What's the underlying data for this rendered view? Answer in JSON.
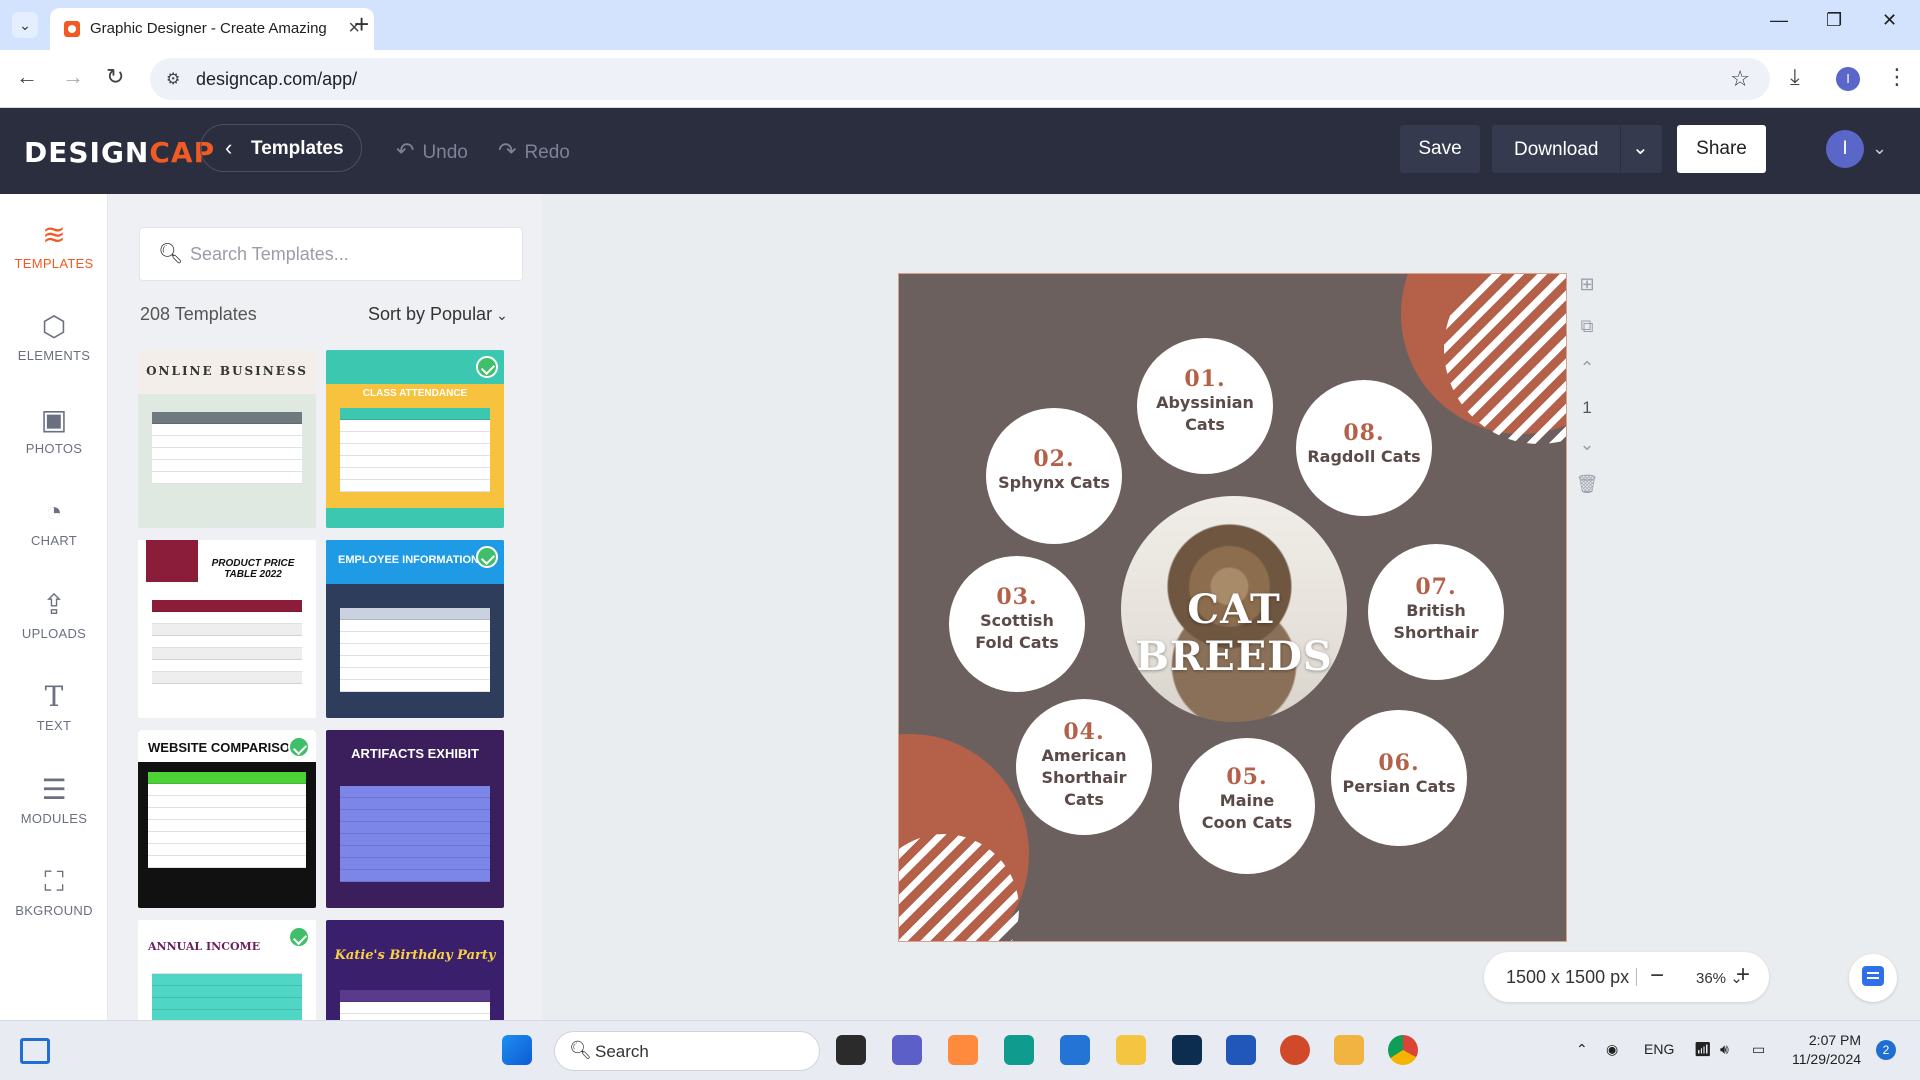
{
  "browser": {
    "tab_title": "Graphic Designer - Create Amazing Graphics",
    "url": "designcap.com/app/",
    "profile_initial": "I"
  },
  "app": {
    "logo_prefix": "DESIGN",
    "logo_suffix": "CAP",
    "templates_button": "Templates",
    "undo": "Undo",
    "redo": "Redo",
    "save": "Save",
    "download": "Download",
    "share": "Share",
    "user_initial": "I"
  },
  "leftnav": [
    {
      "label": "TEMPLATES",
      "icon": "layers-icon",
      "active": true
    },
    {
      "label": "ELEMENTS",
      "icon": "elements-icon"
    },
    {
      "label": "PHOTOS",
      "icon": "photo-icon"
    },
    {
      "label": "CHART",
      "icon": "pie-chart-icon"
    },
    {
      "label": "UPLOADS",
      "icon": "upload-icon"
    },
    {
      "label": "TEXT",
      "icon": "text-icon"
    },
    {
      "label": "MODULES",
      "icon": "list-icon"
    },
    {
      "label": "BKGROUND",
      "icon": "background-icon"
    }
  ],
  "panel": {
    "search_placeholder": "Search Templates...",
    "count": "208 Templates",
    "sort": "Sort by Popular",
    "thumbnails": [
      {
        "title": "ONLINE BUSINESS",
        "premium": false
      },
      {
        "title": "CLASS ATTENDANCE",
        "premium": true
      },
      {
        "title": "PRODUCT PRICE TABLE 2022",
        "premium": false
      },
      {
        "title": "EMPLOYEE INFORMATION",
        "premium": true
      },
      {
        "title": "WEBSITE COMPARISON",
        "premium": true
      },
      {
        "title": "ARTIFACTS EXHIBIT",
        "premium": false
      },
      {
        "title": "ANNUAL INCOME",
        "premium": true
      },
      {
        "title": "Katie's Birthday Party",
        "premium": false
      }
    ]
  },
  "design": {
    "title": "CAT BREEDS",
    "colors": {
      "background": "#6c605f",
      "accent": "#b5614a"
    },
    "breeds": [
      {
        "num": "01.",
        "name": "Abyssinian Cats"
      },
      {
        "num": "02.",
        "name": "Sphynx Cats"
      },
      {
        "num": "03.",
        "name": "Scottish Fold Cats"
      },
      {
        "num": "04.",
        "name": "American Shorthair Cats"
      },
      {
        "num": "05.",
        "name": "Maine Coon Cats"
      },
      {
        "num": "06.",
        "name": "Persian Cats"
      },
      {
        "num": "07.",
        "name": "British Shorthair"
      },
      {
        "num": "08.",
        "name": "Ragdoll Cats"
      }
    ]
  },
  "canvas": {
    "page_number": "1",
    "dimensions": "1500 x 1500 px",
    "zoom": "36%"
  },
  "taskbar": {
    "search": "Search",
    "language": "ENG",
    "time": "2:07 PM",
    "date": "11/29/2024",
    "notifications": "2"
  }
}
